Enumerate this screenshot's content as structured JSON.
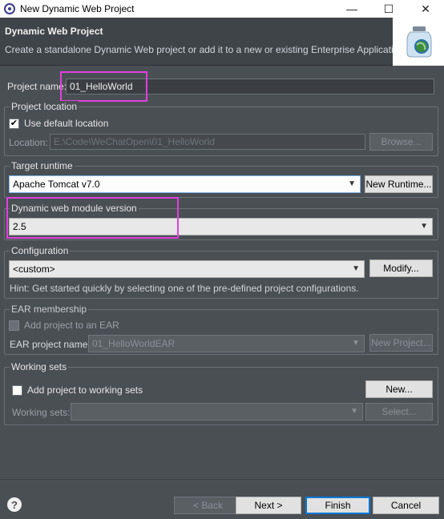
{
  "window": {
    "title": "New Dynamic Web Project",
    "minimize": "—",
    "maximize": "☐",
    "close": "✕"
  },
  "header": {
    "title": "Dynamic Web Project",
    "description": "Create a standalone Dynamic Web project or add it to a new or existing Enterprise Application."
  },
  "project_name": {
    "label": "Project name:",
    "value": "01_HelloWorld"
  },
  "project_location": {
    "title": "Project location",
    "use_default_label": "Use default location",
    "use_default_checked": true,
    "location_label": "Location:",
    "location_value": "E:\\Code\\WeChatOpen\\01_HelloWorld",
    "browse_label": "Browse..."
  },
  "target_runtime": {
    "title": "Target runtime",
    "selected": "Apache Tomcat v7.0",
    "new_runtime_label": "New Runtime..."
  },
  "module_version": {
    "title": "Dynamic web module version",
    "selected": "2.5"
  },
  "configuration": {
    "title": "Configuration",
    "selected": "<custom>",
    "modify_label": "Modify...",
    "hint": "Hint: Get started quickly by selecting one of the pre-defined project configurations."
  },
  "ear": {
    "title": "EAR membership",
    "add_label": "Add project to an EAR",
    "project_name_label": "EAR project name:",
    "project_name_value": "01_HelloWorldEAR",
    "new_project_label": "New Project..."
  },
  "working_sets": {
    "title": "Working sets",
    "add_label": "Add project to working sets",
    "new_label": "New...",
    "sets_label": "Working sets:",
    "select_label": "Select..."
  },
  "footer": {
    "help_icon": "?",
    "back_label": "< Back",
    "next_label": "Next >",
    "finish_label": "Finish",
    "cancel_label": "Cancel"
  },
  "colors": {
    "highlight": "#e040e0",
    "background": "#4a4f54"
  }
}
